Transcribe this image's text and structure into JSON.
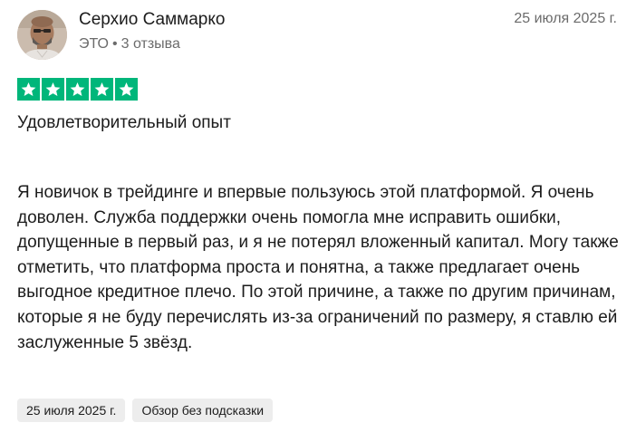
{
  "author": {
    "name": "Серхио Саммарко",
    "country": "ЭТО",
    "separator": "•",
    "reviews_count": "3 отзыва"
  },
  "review": {
    "date": "25 июля 2025 г.",
    "rating": 5,
    "rating_max": 5,
    "star_color": "#00b67a",
    "title": "Удовлетворительный опыт",
    "body": "Я новичок в трейдинге и впервые пользуюсь этой платформой. Я очень доволен. Служба поддержки очень помогла мне исправить ошибки, допущенные в первый раз, и я не потерял вложенный капитал. Могу также отметить, что платформа проста и понятна, а также предлагает очень выгодное кредитное плечо. По этой причине, а также по другим причинам, которые я не буду перечислять из-за ограничений по размеру, я ставлю ей заслуженные 5 звёзд."
  },
  "tags": {
    "experience_date": "25 июля 2025 г.",
    "review_type": "Обзор без подсказки"
  }
}
